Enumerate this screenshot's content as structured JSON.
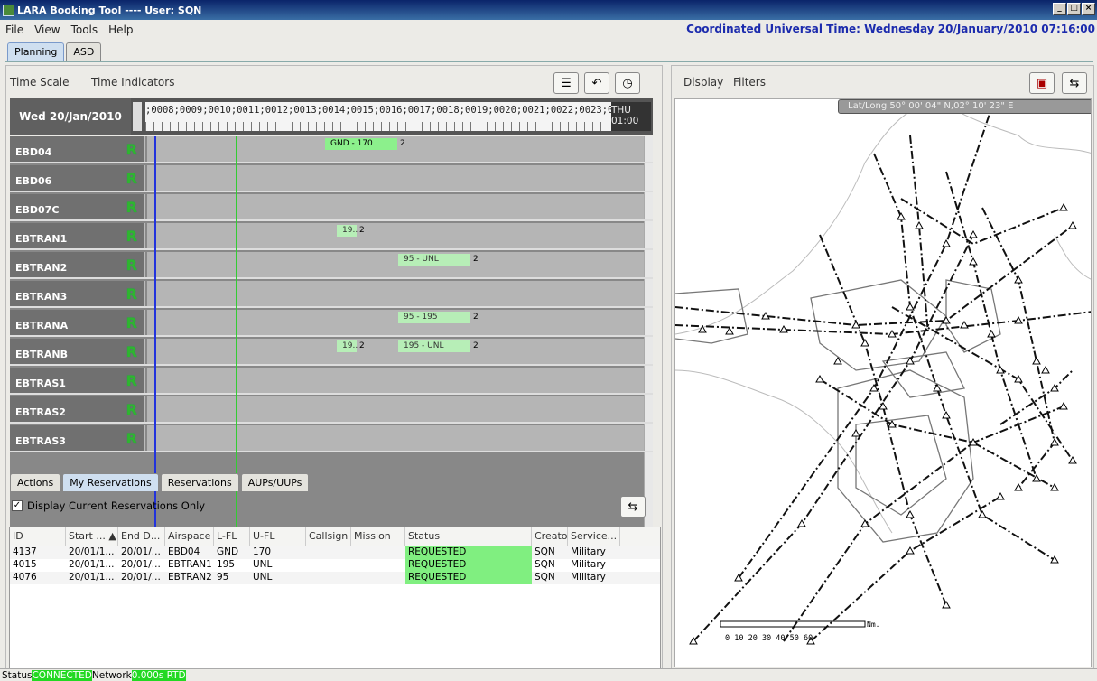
{
  "window": {
    "title": "LARA Booking Tool ---- User: SQN"
  },
  "menu": [
    "File",
    "View",
    "Tools",
    "Help"
  ],
  "utc_label": "Coordinated Universal Time: Wednesday 20/January/2010  07:16:00",
  "top_tabs": [
    {
      "label": "Planning",
      "active": true
    },
    {
      "label": "ASD",
      "active": false
    }
  ],
  "planning": {
    "toolbar": {
      "time_scale": "Time Scale",
      "time_indicators": "Time Indicators"
    },
    "date": "Wed 20/Jan/2010",
    "hours": ";0008;0009;0010;0011;0012;0013;0014;0015;0016;0017;0018;0019;0020;0021;0022;0023;00",
    "next_day": "THU 01:00",
    "rows": [
      {
        "name": "EBD04",
        "status": "R",
        "res": [
          {
            "label": "GND - 170",
            "count": "2"
          }
        ]
      },
      {
        "name": "EBD06",
        "status": "R",
        "res": []
      },
      {
        "name": "EBD07C",
        "status": "R",
        "res": []
      },
      {
        "name": "EBTRAN1",
        "status": "R",
        "res": [
          {
            "label": "19..",
            "count": "2"
          }
        ]
      },
      {
        "name": "EBTRAN2",
        "status": "R",
        "res": [
          {
            "label": "95 - UNL",
            "count": "2"
          }
        ]
      },
      {
        "name": "EBTRAN3",
        "status": "R",
        "res": []
      },
      {
        "name": "EBTRANA",
        "status": "R",
        "res": [
          {
            "label": "95 - 195",
            "count": "2"
          }
        ]
      },
      {
        "name": "EBTRANB",
        "status": "R",
        "res": [
          {
            "label": "19..",
            "count": "2"
          },
          {
            "label": "195 - UNL",
            "count": "2"
          }
        ]
      },
      {
        "name": "EBTRAS1",
        "status": "R",
        "res": []
      },
      {
        "name": "EBTRAS2",
        "status": "R",
        "res": []
      },
      {
        "name": "EBTRAS3",
        "status": "R",
        "res": []
      }
    ]
  },
  "bottom_tabs": [
    {
      "label": "Actions"
    },
    {
      "label": "My Reservations",
      "active": true
    },
    {
      "label": "Reservations"
    },
    {
      "label": "AUPs/UUPs"
    }
  ],
  "filter_checkbox": "Display Current Reservations Only",
  "table": {
    "columns": [
      "ID",
      "Start ... ▲",
      "End D...",
      "Airspace",
      "L-FL",
      "U-FL",
      "Callsign",
      "Mission",
      "Status",
      "Creator",
      "Service..."
    ],
    "rows": [
      [
        "4137",
        "20/01/1...",
        "20/01/...",
        "EBD04",
        "GND",
        "170",
        "",
        "",
        "REQUESTED",
        "SQN",
        "Military"
      ],
      [
        "4015",
        "20/01/1...",
        "20/01/...",
        "EBTRAN1",
        "195",
        "UNL",
        "",
        "",
        "REQUESTED",
        "SQN",
        "Military"
      ],
      [
        "4076",
        "20/01/1...",
        "20/01/...",
        "EBTRAN2",
        "95",
        "UNL",
        "",
        "",
        "REQUESTED",
        "SQN",
        "Military"
      ]
    ]
  },
  "map": {
    "toolbar": {
      "display": "Display",
      "filters": "Filters"
    },
    "latlong": "Lat/Long   50° 00' 04\" N,02° 10' 23\" E",
    "scale_labels": "0   10   20   30   40   50   60",
    "scale_unit": "Nm."
  },
  "status": {
    "status_label": "Status",
    "status_value": "CONNECTED",
    "network_label": "Network",
    "network_value": "0.000s RTD"
  },
  "colors": {
    "accent": "#1c2bad",
    "reserved": "#80ef80"
  }
}
